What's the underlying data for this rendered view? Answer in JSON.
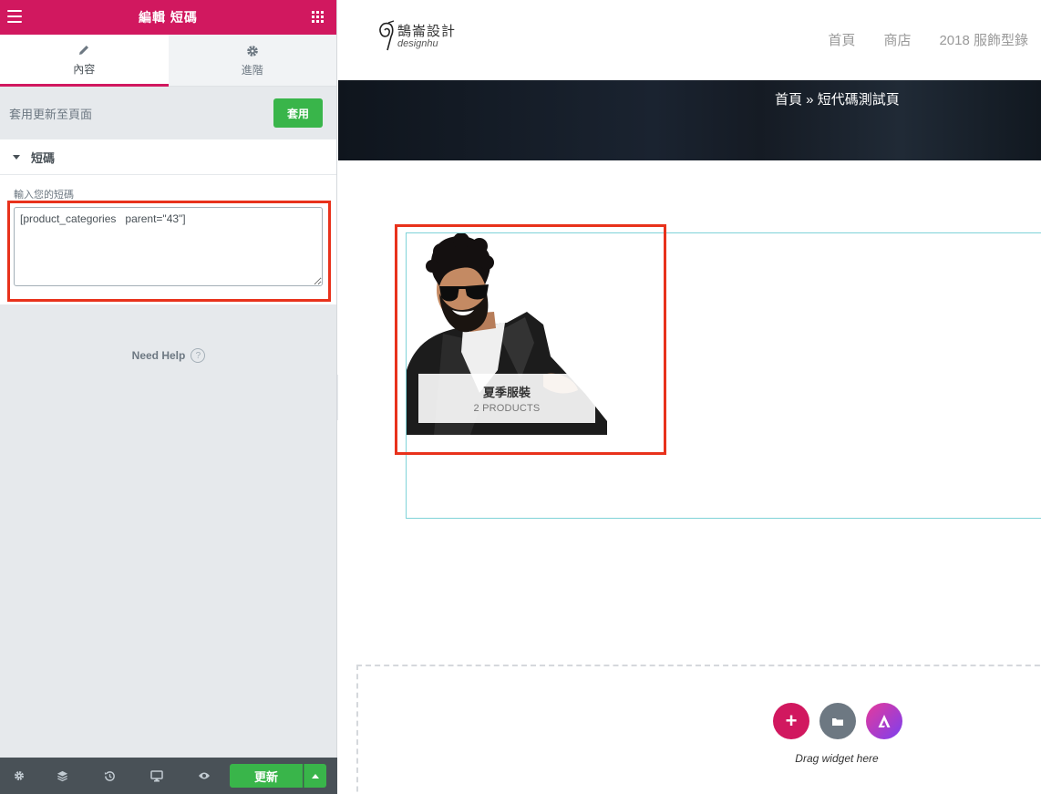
{
  "editor": {
    "header_title": "編輯 短碼",
    "tabs": [
      {
        "label": "內容",
        "icon": "pencil-icon"
      },
      {
        "label": "進階",
        "icon": "gear-icon"
      }
    ],
    "apply_label": "套用更新至頁面",
    "apply_button": "套用",
    "section_title": "短碼",
    "field_label": "輸入您的短碼",
    "shortcode_value": "[product_categories   parent=\"43\"]",
    "help_text": "Need Help",
    "help_icon": "?",
    "update_button": "更新",
    "colors": {
      "brand": "#d1185f",
      "apply": "#39b54a",
      "highlight": "#e8321c"
    }
  },
  "site": {
    "logo_cn": "鵠崙設計",
    "logo_en": "designhu",
    "nav": [
      "首頁",
      "商店",
      "2018 服飾型錄"
    ],
    "breadcrumb": {
      "home": "首頁",
      "sep": " » ",
      "current": "短代碼測試頁"
    }
  },
  "product_category": {
    "name": "夏季服裝",
    "count": "2 PRODUCTS"
  },
  "drop_zone": {
    "text": "Drag widget here",
    "add_symbol": "+"
  }
}
